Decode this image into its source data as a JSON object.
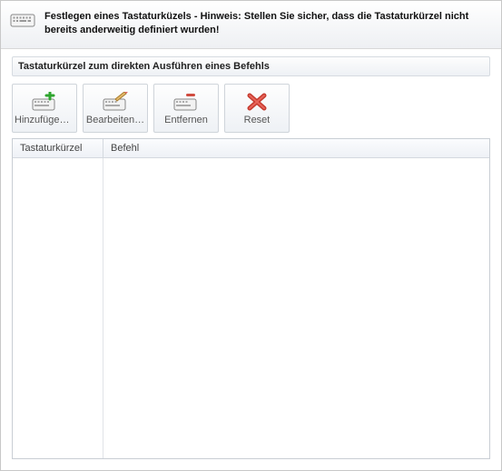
{
  "banner": {
    "text": "Festlegen eines Tastaturküzels - Hinweis: Stellen Sie sicher, dass die Tastaturkürzel nicht bereits anderweitig definiert wurden!"
  },
  "section": {
    "title": "Tastaturkürzel zum direkten Ausführen eines Befehls"
  },
  "toolbar": {
    "add_label": "Hinzufügen…",
    "edit_label": "Bearbeiten…",
    "remove_label": "Entfernen",
    "reset_label": "Reset"
  },
  "table": {
    "col_shortcut": "Tastaturkürzel",
    "col_command": "Befehl",
    "rows": []
  }
}
